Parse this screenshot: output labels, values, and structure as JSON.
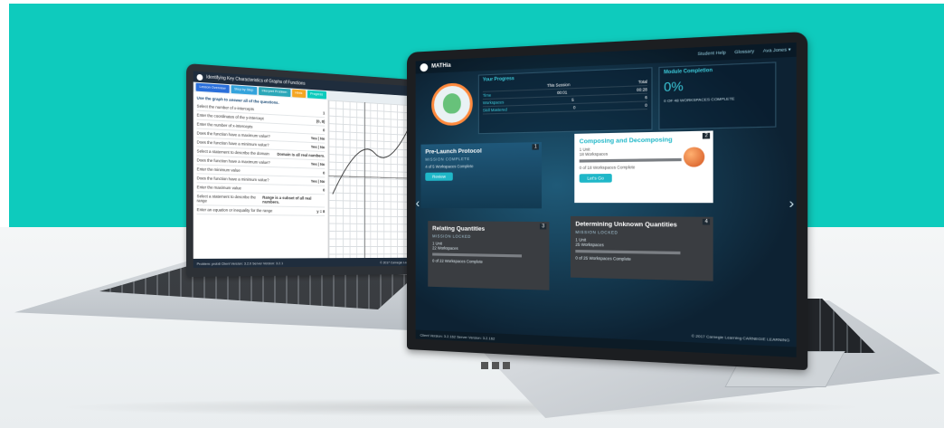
{
  "colors": {
    "teal_background": "#0ecbbd",
    "accent": "#1fb7c8",
    "planet_orange": "#d3541f"
  },
  "left_app": {
    "title": "Identifying Key Characteristics of Graphs of Functions",
    "tabs": [
      {
        "label": "Lesson Overview",
        "color": "#2a6fdb"
      },
      {
        "label": "Step by Step",
        "color": "#33a3dc"
      },
      {
        "label": "Interpret Problem",
        "color": "#2ba7b8"
      },
      {
        "label": "Hints",
        "color": "#f5a623"
      },
      {
        "label": "Progress",
        "color": "#0ecbbd"
      }
    ],
    "prompt": "Use the graph to answer all of the questions.",
    "questions": [
      {
        "label": "Select the number of x-intercepts",
        "value": "1"
      },
      {
        "label": "Enter the coordinates of the y-intercept",
        "value": "(0, 8)"
      },
      {
        "label": "Enter the number of x-intercepts",
        "value": "0"
      },
      {
        "label": "Does the function have a maximum value?",
        "value": "Yes | No"
      },
      {
        "label": "Does the function have a minimum value?",
        "value": "Yes | No"
      },
      {
        "label": "Select a statement to describe the domain",
        "value": "Domain is all real numbers."
      },
      {
        "label": "Does the function have a maximum value?",
        "value": "Yes | No"
      },
      {
        "label": "Enter the minimum value",
        "value": "0"
      },
      {
        "label": "Does the function have a minimum value?",
        "value": "Yes | No"
      },
      {
        "label": "Enter the maximum value",
        "value": "0"
      },
      {
        "label": "Select a statement to describe the range",
        "value": "Range is a subset of all real numbers."
      },
      {
        "label": "Enter an equation or inequality for the range",
        "value": "y = 8"
      }
    ],
    "footer_left": "Problem: prob8   Client Version: 3.2.0   Server Version: 3.2.1",
    "footer_right": "© 2017 Carnegie Learning"
  },
  "right_app": {
    "brand": "MATHia",
    "nav": [
      "Student Help",
      "Glossary",
      "Ava Jones ▾"
    ],
    "progress": {
      "heading": "Your Progress",
      "columns": [
        "",
        "This Session",
        "Total"
      ],
      "rows": [
        {
          "label": "Time",
          "session": "00:01",
          "total": "00:28"
        },
        {
          "label": "Workspaces",
          "session": "5",
          "total": "6"
        },
        {
          "label": "Skill Mastered",
          "session": "0",
          "total": "0"
        }
      ]
    },
    "completion": {
      "heading": "Module Completion",
      "percent": "0%",
      "note": "0 OF 48 WORKSPACES COMPLETE"
    },
    "cards": [
      {
        "num": "1",
        "title": "Pre-Launch Protocol",
        "status": "MISSION COMPLETE",
        "line": "4 of 5 Workspaces Complete",
        "button": "Review"
      },
      {
        "num": "2",
        "title": "Composing and Decomposing",
        "status": "",
        "line1": "1 Unit",
        "line2": "18 Workspaces",
        "line3": "0 of 18 Workspaces Complete",
        "button": "Let's Go"
      },
      {
        "num": "3",
        "title": "Relating Quantities",
        "status": "MISSION LOCKED",
        "line1": "1 Unit",
        "line2": "22 Workspaces",
        "line3": "0 of 22 Workspaces Complete"
      },
      {
        "num": "4",
        "title": "Determining Unknown Quantities",
        "status": "MISSION LOCKED",
        "line1": "1 Unit",
        "line2": "25 Workspaces",
        "line3": "0 of 25 Workspaces Complete"
      }
    ],
    "copyright": "© 2017 Carnegie Learning",
    "footer_versions": "Client Version: 3.2.162    Server Version: 3.2.162",
    "company": "CARNEGIE LEARNING"
  }
}
